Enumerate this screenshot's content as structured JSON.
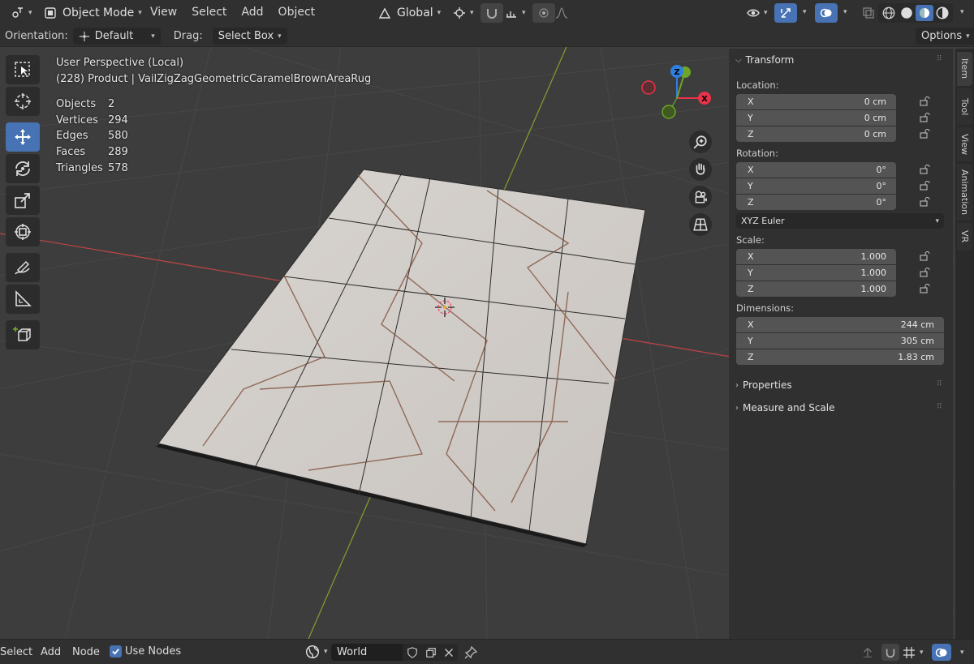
{
  "header": {
    "mode": "Object Mode",
    "menus": [
      "View",
      "Select",
      "Add",
      "Object"
    ],
    "transform_orientation": "Global"
  },
  "toolsettings": {
    "orientation_label": "Orientation:",
    "orientation_value": "Default",
    "drag_label": "Drag:",
    "drag_value": "Select Box",
    "options": "Options"
  },
  "viewport": {
    "view_name": "User Perspective (Local)",
    "object_line": "(228) Product | VailZigZagGeometricCaramelBrownAreaRug",
    "stats": [
      {
        "label": "Objects",
        "value": "2"
      },
      {
        "label": "Vertices",
        "value": "294"
      },
      {
        "label": "Edges",
        "value": "580"
      },
      {
        "label": "Faces",
        "value": "289"
      },
      {
        "label": "Triangles",
        "value": "578"
      }
    ],
    "gizmo": {
      "z": "Z",
      "x": "X"
    }
  },
  "npanel": {
    "transform": "Transform",
    "location_label": "Location:",
    "location": [
      {
        "axis": "X",
        "value": "0 cm"
      },
      {
        "axis": "Y",
        "value": "0 cm"
      },
      {
        "axis": "Z",
        "value": "0 cm"
      }
    ],
    "rotation_label": "Rotation:",
    "rotation": [
      {
        "axis": "X",
        "value": "0°"
      },
      {
        "axis": "Y",
        "value": "0°"
      },
      {
        "axis": "Z",
        "value": "0°"
      }
    ],
    "rotation_mode": "XYZ Euler",
    "scale_label": "Scale:",
    "scale": [
      {
        "axis": "X",
        "value": "1.000"
      },
      {
        "axis": "Y",
        "value": "1.000"
      },
      {
        "axis": "Z",
        "value": "1.000"
      }
    ],
    "dimensions_label": "Dimensions:",
    "dimensions": [
      {
        "axis": "X",
        "value": "244 cm"
      },
      {
        "axis": "Y",
        "value": "305 cm"
      },
      {
        "axis": "Z",
        "value": "1.83 cm"
      }
    ],
    "properties": "Properties",
    "measure": "Measure and Scale"
  },
  "tabs": [
    "Item",
    "Tool",
    "View",
    "Animation",
    "VR"
  ],
  "bottom": {
    "select": "Select",
    "add": "Add",
    "node": "Node",
    "use_nodes": "Use Nodes",
    "world": "World"
  },
  "colors": {
    "accent": "#4772b3",
    "axis_x": "#e8334a",
    "axis_y": "#6ea526",
    "axis_z": "#2f7fe0"
  }
}
